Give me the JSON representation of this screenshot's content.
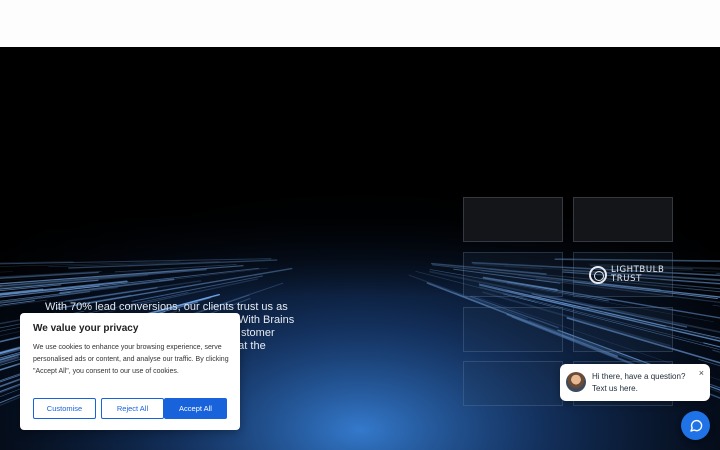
{
  "hero": {
    "text_lines": [
      "With 70% lead conversions, our clients trust us as",
      "With Brains",
      "stomer",
      "e at the"
    ]
  },
  "logos": {
    "lightbulb": {
      "line1": "LIGHTBULB",
      "line2": "TRUST"
    }
  },
  "cookie_banner": {
    "title": "We value your privacy",
    "body": "We use cookies to enhance your browsing experience, serve personalised ads or content, and analyse our traffic. By clicking \"Accept All\", you consent to our use of cookies.",
    "customise_label": "Customise",
    "reject_label": "Reject All",
    "accept_label": "Accept All"
  },
  "chat": {
    "message": "Hi there, have a question? Text us here.",
    "close_glyph": "×"
  }
}
